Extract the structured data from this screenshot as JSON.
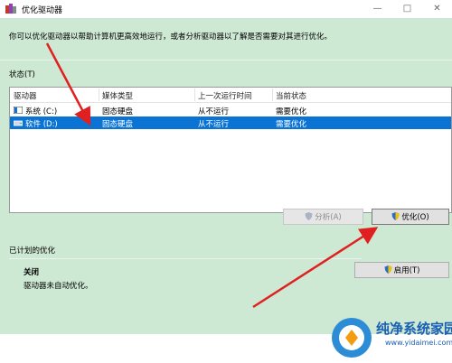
{
  "window": {
    "title": "优化驱动器"
  },
  "description": "你可以优化驱动器以帮助计算机更高效地运行，或者分析驱动器以了解是否需要对其进行优化。",
  "status_label": "状态(T)",
  "drive_list": {
    "columns": [
      "驱动器",
      "媒体类型",
      "上一次运行时间",
      "当前状态"
    ],
    "rows": [
      {
        "drive": "系统 (C:)",
        "media": "固态硬盘",
        "last_run": "从不运行",
        "status": "需要优化"
      },
      {
        "drive": "软件 (D:)",
        "media": "固态硬盘",
        "last_run": "从不运行",
        "status": "需要优化"
      }
    ]
  },
  "buttons": {
    "analyze": "分析(A)",
    "optimize": "优化(O)",
    "enable": "启用(T)"
  },
  "scheduled": {
    "title": "已计划的优化",
    "state": "关闭",
    "description": "驱动器未自动优化。"
  },
  "watermark": {
    "text": "纯净系统家园",
    "url": "www.yidaimei.com"
  },
  "colors": {
    "accent": "#0a73d4",
    "annotation_arrow": "#e02020",
    "background": "#cde8d3"
  }
}
